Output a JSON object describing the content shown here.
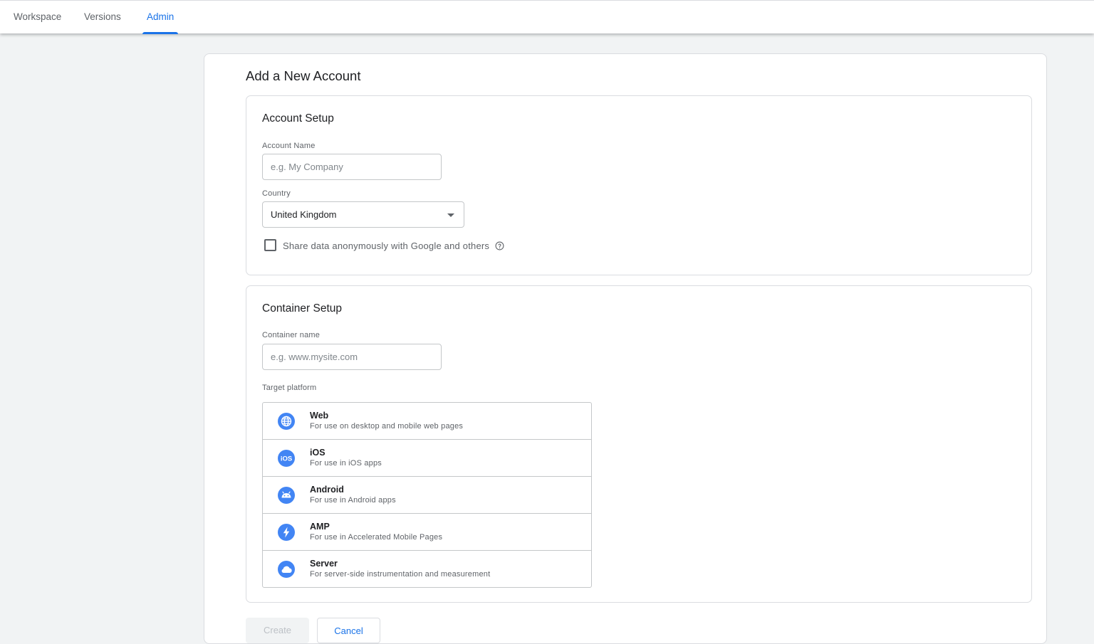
{
  "tabs": [
    {
      "label": "Workspace",
      "active": false
    },
    {
      "label": "Versions",
      "active": false
    },
    {
      "label": "Admin",
      "active": true
    }
  ],
  "page": {
    "title": "Add a New Account"
  },
  "account_setup": {
    "title": "Account Setup",
    "account_name_label": "Account Name",
    "account_name_placeholder": "e.g. My Company",
    "account_name_value": "",
    "country_label": "Country",
    "country_value": "United Kingdom",
    "share_data_label": "Share data anonymously with Google and others",
    "share_data_checked": false
  },
  "container_setup": {
    "title": "Container Setup",
    "container_name_label": "Container name",
    "container_name_placeholder": "e.g. www.mysite.com",
    "container_name_value": "",
    "target_platform_label": "Target platform",
    "platforms": [
      {
        "name": "Web",
        "description": "For use on desktop and mobile web pages",
        "icon": "globe-icon"
      },
      {
        "name": "iOS",
        "description": "For use in iOS apps",
        "icon": "ios-icon"
      },
      {
        "name": "Android",
        "description": "For use in Android apps",
        "icon": "android-icon"
      },
      {
        "name": "AMP",
        "description": "For use in Accelerated Mobile Pages",
        "icon": "amp-bolt-icon"
      },
      {
        "name": "Server",
        "description": "For server-side instrumentation and measurement",
        "icon": "cloud-icon"
      }
    ]
  },
  "actions": {
    "create_label": "Create",
    "cancel_label": "Cancel"
  },
  "colors": {
    "accent": "#1a73e8",
    "icon_blue": "#4285f4",
    "page_background": "#f1f3f4"
  }
}
